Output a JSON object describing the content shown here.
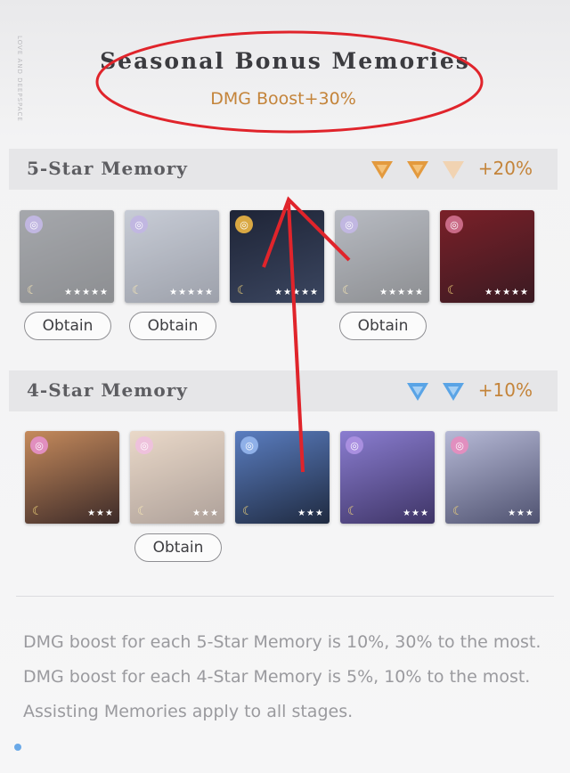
{
  "side_logo": "LOVE AND DEEPSPACE",
  "title": "Seasonal Bonus Memories",
  "subtitle": "DMG Boost+30%",
  "five_star": {
    "label": "5-Star Memory",
    "bonus": "+20%",
    "tri_color": "#e39a3e",
    "tri_faded_color": "#f1d3b2",
    "cards": [
      {
        "badge_color": "#8f7cc9",
        "stars": "★★★★★",
        "art": [
          "#5c6068",
          "#2f3238"
        ],
        "obtain": "Obtain",
        "dim": true
      },
      {
        "badge_color": "#8f7cc9",
        "stars": "★★★★★",
        "art": [
          "#9aa2b4",
          "#4d5466"
        ],
        "obtain": "Obtain",
        "dim": true
      },
      {
        "badge_color": "#d9a843",
        "stars": "★★★★★",
        "art": [
          "#1e2436",
          "#3b4660"
        ],
        "obtain": "",
        "dim": false
      },
      {
        "badge_color": "#8f7cc9",
        "stars": "★★★★★",
        "art": [
          "#7d8390",
          "#2f3238"
        ],
        "obtain": "Obtain",
        "dim": true
      },
      {
        "badge_color": "#c96a86",
        "stars": "★★★★★",
        "art": [
          "#7a2028",
          "#3a1a22"
        ],
        "obtain": "",
        "dim": false
      }
    ]
  },
  "four_star": {
    "label": "4-Star Memory",
    "bonus": "+10%",
    "tri_color": "#5aa4e6",
    "cards": [
      {
        "badge_color": "#e18fbf",
        "stars": "★★★",
        "art": [
          "#c58a5c",
          "#3c2a28"
        ],
        "obtain": "",
        "dim": false
      },
      {
        "badge_color": "#e18fbf",
        "stars": "★★★",
        "art": [
          "#d8b99c",
          "#6b5346"
        ],
        "obtain": "Obtain",
        "dim": true
      },
      {
        "badge_color": "#8fb0e8",
        "stars": "★★★",
        "art": [
          "#5a7dc0",
          "#1f2a40"
        ],
        "obtain": "",
        "dim": false
      },
      {
        "badge_color": "#a98fe0",
        "stars": "★★★",
        "art": [
          "#8a7dd0",
          "#3e3466"
        ],
        "obtain": "",
        "dim": false
      },
      {
        "badge_color": "#e18fbf",
        "stars": "★★★",
        "art": [
          "#b6b9d6",
          "#4f5270"
        ],
        "obtain": "",
        "dim": false
      }
    ]
  },
  "description": [
    "DMG boost for each 5-Star Memory is 10%, 30% to the most. DMG boost for each 4-Star Memory is 5%, 10% to the most.",
    "Assisting Memories apply to all stages."
  ],
  "annotation_color": "#e0242b"
}
